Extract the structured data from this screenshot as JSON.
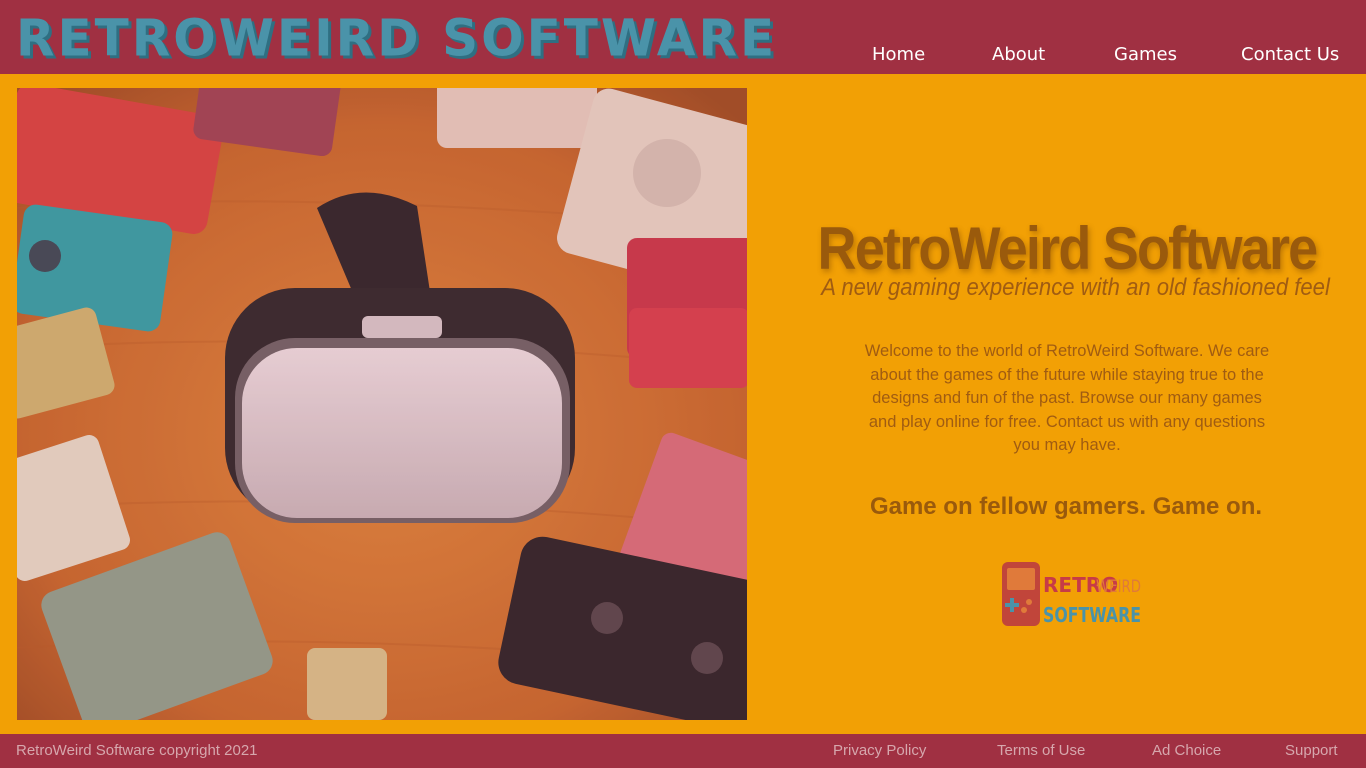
{
  "header": {
    "brand": "RETROWEIRD SOFTWARE",
    "nav": [
      {
        "label": "Home"
      },
      {
        "label": "About"
      },
      {
        "label": "Games"
      },
      {
        "label": "Contact Us"
      }
    ]
  },
  "hero": {
    "title": "RetroWeird Software",
    "tagline": "A new gaming experience with an old fashioned feel",
    "body": "Welcome to the world of RetroWeird Software. We care about the games of the future while staying true to the designs and fun of the past. Browse our many games and play online for free. Contact us with any questions you may have.",
    "cta": "Game on fellow gamers. Game on."
  },
  "logo": {
    "line1a": "RETRO",
    "line1b": "WEIRD",
    "line2": "SOFTWARE"
  },
  "footer": {
    "copyright": "RetroWeird Software copyright 2021",
    "links": [
      {
        "label": "Privacy Policy"
      },
      {
        "label": "Terms of Use"
      },
      {
        "label": "Ad Choice"
      },
      {
        "label": "Support"
      }
    ]
  },
  "colors": {
    "background": "#f2a005",
    "bar": "#a03042",
    "brand_text": "#4a93a9",
    "hero_text": "#9a5a0c"
  }
}
